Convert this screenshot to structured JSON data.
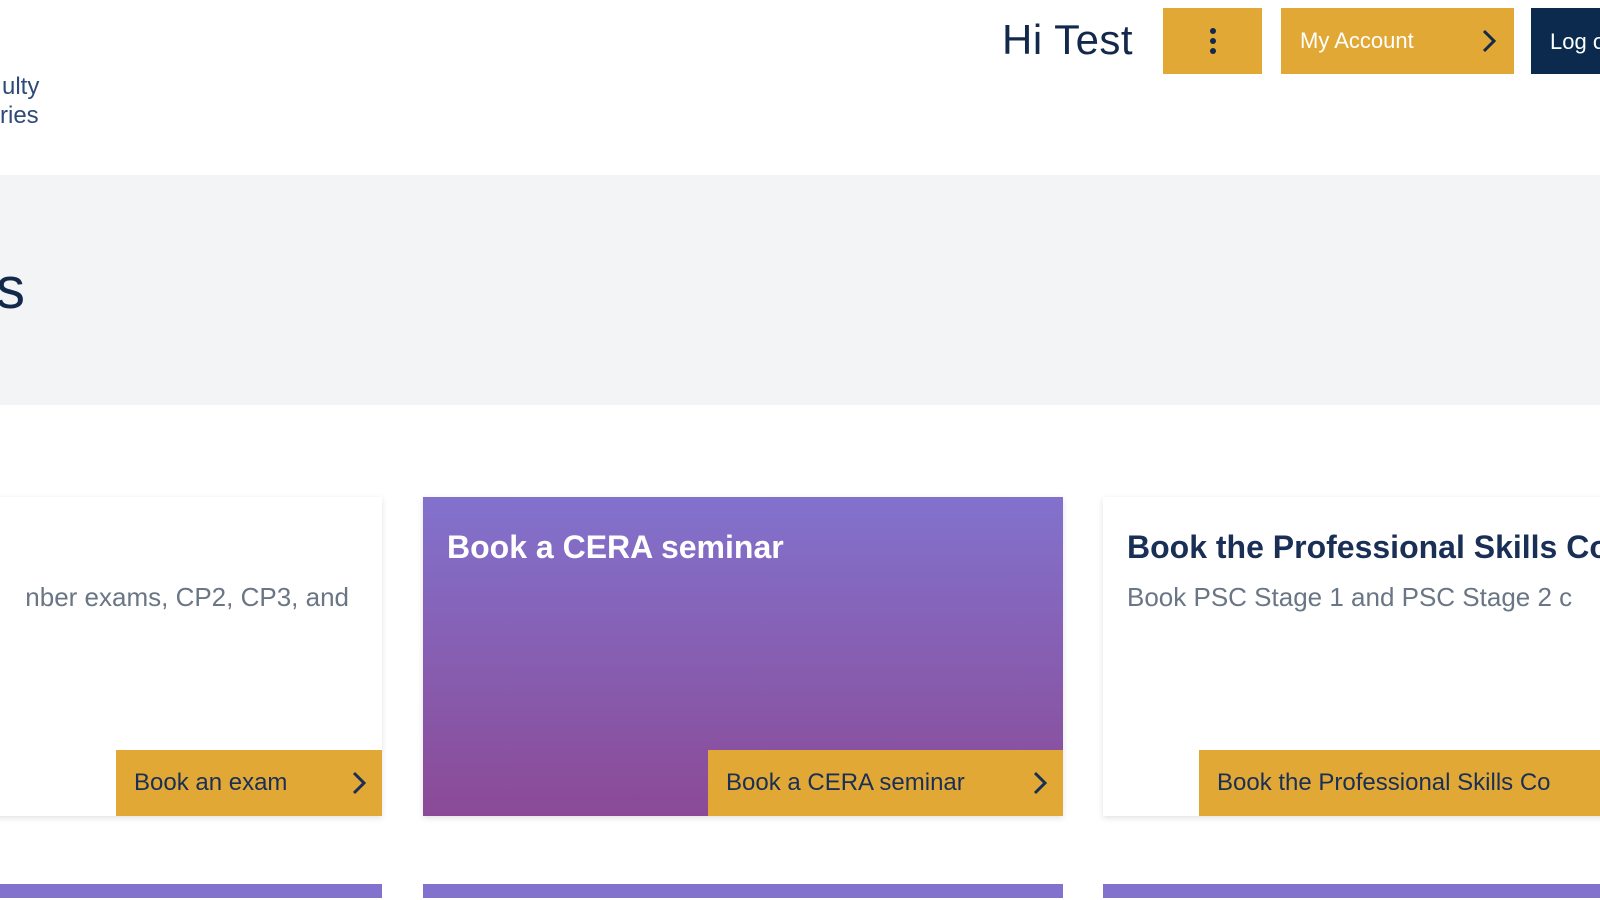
{
  "header": {
    "logo_line1": "ulty",
    "logo_line2": "ries",
    "greeting": "Hi Test",
    "menu_icon": "vertical-ellipsis-icon",
    "account_label": "My Account",
    "logout_label": "Log o",
    "colors": {
      "gold": "#e2a836",
      "navy": "#0c2a4e"
    }
  },
  "hero": {
    "title": "s",
    "background": "#f3f4f6"
  },
  "cards": [
    {
      "title": "",
      "description": "nber exams, CP2, CP3, and",
      "button_label": "Book an exam"
    },
    {
      "title": "Book a CERA seminar",
      "description": "",
      "button_label": "Book a CERA seminar",
      "gradient": [
        "#8272cd",
        "#8b4a96"
      ]
    },
    {
      "title": "Book the Professional Skills Co",
      "description": "Book PSC Stage 1 and PSC Stage 2 c",
      "button_label": "Book the Professional Skills Co"
    }
  ],
  "strip_color": "#8272cd"
}
